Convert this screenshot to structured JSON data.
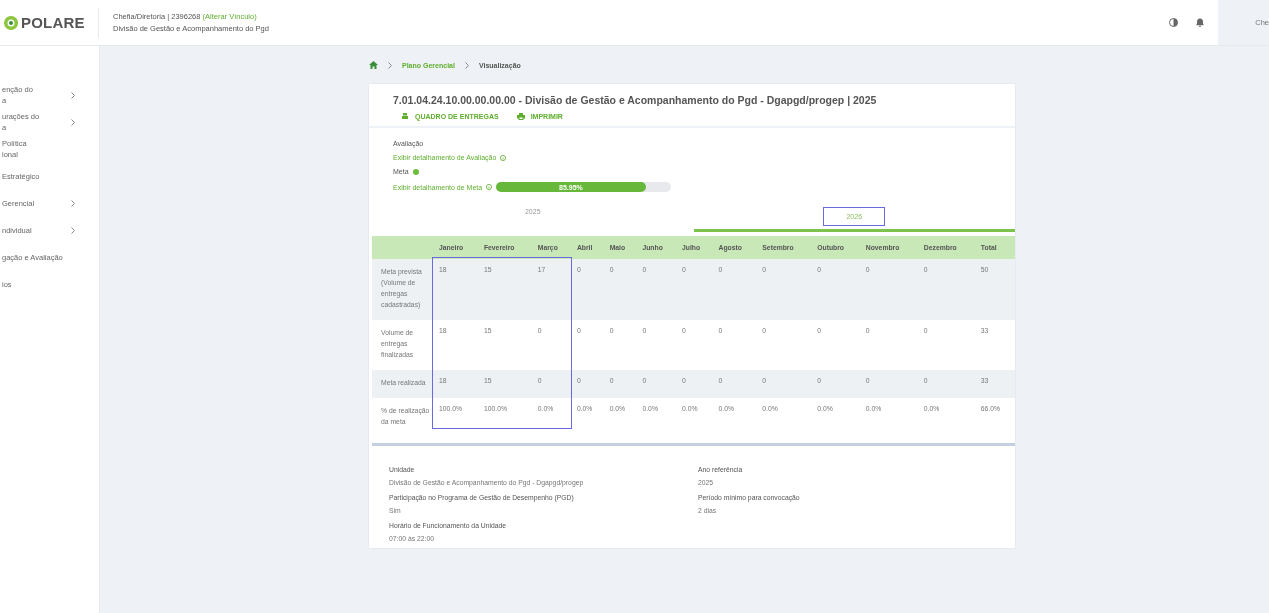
{
  "header": {
    "logo": "POLARE",
    "role": "Chefia/Diretoria | 2396268",
    "change_link": "(Alterar Vínculo)",
    "unit": "Divisão de Gestão e Acompanhamento do Pgd",
    "user": "Che"
  },
  "sidebar": {
    "items": [
      {
        "label": "enção do\na",
        "has_children": true
      },
      {
        "label": "urações do\na",
        "has_children": true
      },
      {
        "label": "Política\nional",
        "has_children": false
      },
      {
        "label": "Estratégico",
        "has_children": false
      },
      {
        "label": "Gerencial",
        "has_children": true
      },
      {
        "label": "ndividual",
        "has_children": true
      },
      {
        "label": "gação e Avaliação",
        "has_children": false
      },
      {
        "label": "ios",
        "has_children": false
      }
    ]
  },
  "breadcrumb": [
    "Plano Gerencial",
    "Visualização"
  ],
  "card": {
    "title": "7.01.04.24.10.00.00.00.00 - Divisão de Gestão e Acompanhamento do Pgd - Dgapgd/progep | 2025",
    "actions": [
      {
        "kind": "board",
        "label": "QUADRO DE ENTREGAS"
      },
      {
        "kind": "print",
        "label": "IMPRIMIR"
      }
    ],
    "evaluation": {
      "label": "Avaliação",
      "link": "Exibir detalhamento de Avaliação"
    },
    "meta": {
      "label": "Meta",
      "link": "Exibir detalhamento de Meta",
      "progress": {
        "level": 0.855,
        "label": "85.95%"
      }
    },
    "year_tabs": [
      {
        "label": "2025",
        "selected": false,
        "annotated": false
      },
      {
        "label": "2026",
        "selected": true,
        "annotated": true
      }
    ],
    "table": {
      "columns": [
        {
          "label": "Janeiro",
          "highlighted": true
        },
        {
          "label": "Fevereiro",
          "highlighted": true
        },
        {
          "label": "Março",
          "highlighted": true
        },
        {
          "label": "Abril",
          "highlighted": false
        },
        {
          "label": "Maio",
          "highlighted": false
        },
        {
          "label": "Junho",
          "highlighted": false
        },
        {
          "label": "Julho",
          "highlighted": false
        },
        {
          "label": "Agosto",
          "highlighted": false
        },
        {
          "label": "Setembro",
          "highlighted": false
        },
        {
          "label": "Outubro",
          "highlighted": false
        },
        {
          "label": "Novembro",
          "highlighted": false
        },
        {
          "label": "Dezembro",
          "highlighted": false
        },
        {
          "label": "Total",
          "highlighted": false
        }
      ],
      "rows": [
        {
          "label": "Meta prevista (Volume de entregas cadastradas)",
          "cells": [
            "18",
            "15",
            "17",
            "0",
            "0",
            "0",
            "0",
            "0",
            "0",
            "0",
            "0",
            "0",
            "50"
          ]
        },
        {
          "label": "Volume de entregas finalizadas",
          "cells": [
            "18",
            "15",
            "0",
            "0",
            "0",
            "0",
            "0",
            "0",
            "0",
            "0",
            "0",
            "0",
            "33"
          ]
        },
        {
          "label": "Meta realizada",
          "cells": [
            "18",
            "15",
            "0",
            "0",
            "0",
            "0",
            "0",
            "0",
            "0",
            "0",
            "0",
            "0",
            "33"
          ]
        },
        {
          "label": "% de realização da meta",
          "cells": [
            "100.0%",
            "100.0%",
            "0.0%",
            "0.0%",
            "0.0%",
            "0.0%",
            "0.0%",
            "0.0%",
            "0.0%",
            "0.0%",
            "0.0%",
            "0.0%",
            "66.0%"
          ]
        }
      ]
    },
    "info": [
      {
        "label": "Unidade",
        "value": "Divisão de Gestão e Acompanhamento do Pgd - Dgapgd/progep"
      },
      {
        "label": "Ano referência",
        "value": "2025"
      },
      {
        "label": "Participação no Programa de Gestão de Desempenho (PGD)",
        "value": "Sim"
      },
      {
        "label": "Período mínimo para convocação",
        "value": "2 dias"
      },
      {
        "label": "Horário de Funcionamento da Unidade",
        "value": "07:00 às 22:00"
      }
    ]
  }
}
